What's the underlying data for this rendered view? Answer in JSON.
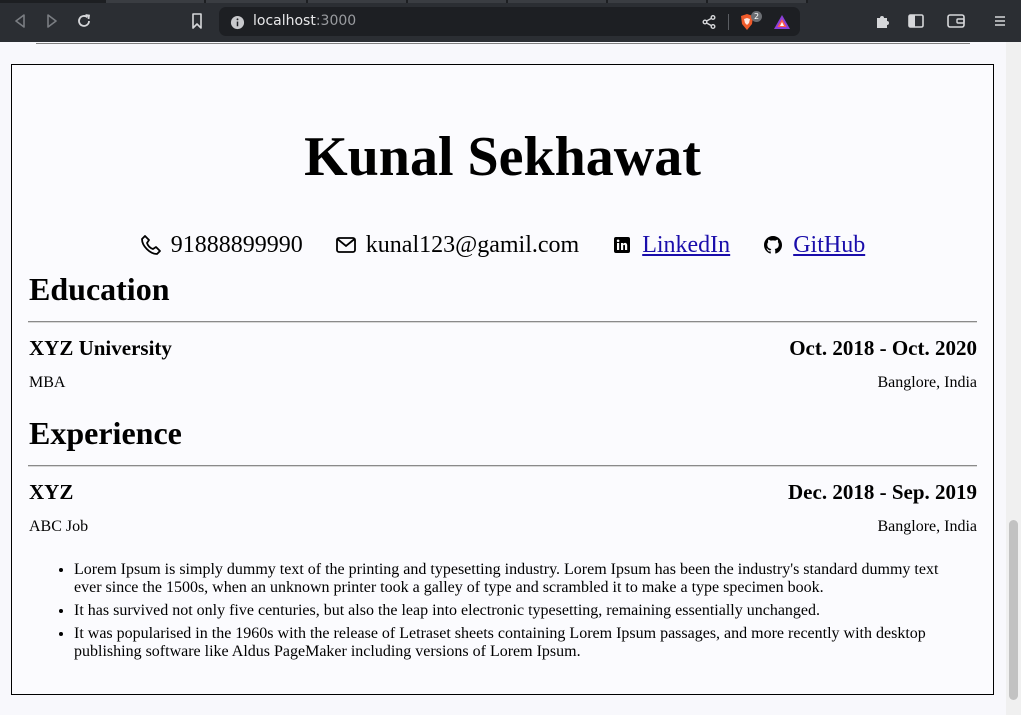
{
  "browser": {
    "url_host": "localhost",
    "url_port": ":3000",
    "shields_count": "2",
    "icons": [
      "back-icon",
      "forward-icon",
      "reload-icon",
      "bookmark-icon",
      "info-icon",
      "share-icon",
      "brave-shields-icon",
      "brave-rewards-icon",
      "extensions-icon",
      "sidebar-icon",
      "wallet-icon",
      "menu-icon"
    ]
  },
  "resume": {
    "name": "Kunal Sekhawat",
    "contacts": {
      "phone": "91888899990",
      "email": "kunal123@gamil.com",
      "linkedin": "LinkedIn",
      "github": "GitHub"
    },
    "education": {
      "title": "Education",
      "entries": [
        {
          "institution": "XYZ University",
          "dates": "Oct. 2018 - Oct. 2020",
          "degree": "MBA",
          "location": "Banglore, India"
        }
      ]
    },
    "experience": {
      "title": "Experience",
      "entries": [
        {
          "company": "XYZ",
          "dates": "Dec. 2018 - Sep. 2019",
          "role": "ABC Job",
          "location": "Banglore, India",
          "points": [
            "Lorem Ipsum is simply dummy text of the printing and typesetting industry. Lorem Ipsum has been the industry's standard dummy text ever since the 1500s, when an unknown printer took a galley of type and scrambled it to make a type specimen book.",
            "It has survived not only five centuries, but also the leap into electronic typesetting, remaining essentially unchanged.",
            "It was popularised in the 1960s with the release of Letraset sheets containing Lorem Ipsum passages, and more recently with desktop publishing software like Aldus PageMaker including versions of Lorem Ipsum."
          ]
        }
      ]
    }
  },
  "colors": {
    "chrome_bg": "#2b2e33",
    "link": "#1a0dab",
    "page_bg": "#fbfbfe"
  }
}
